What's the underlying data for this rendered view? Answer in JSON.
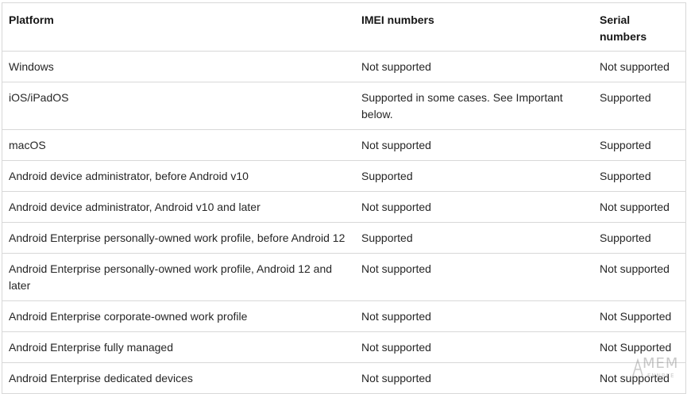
{
  "table": {
    "headers": [
      "Platform",
      "IMEI numbers",
      "Serial numbers"
    ],
    "rows": [
      [
        "Windows",
        "Not supported",
        "Not supported"
      ],
      [
        "iOS/iPadOS",
        "Supported in some cases. See Important below.",
        "Supported"
      ],
      [
        "macOS",
        "Not supported",
        "Supported"
      ],
      [
        "Android device administrator, before Android v10",
        "Supported",
        "Supported"
      ],
      [
        "Android device administrator, Android v10 and later",
        "Not supported",
        "Not supported"
      ],
      [
        "Android Enterprise personally-owned work profile, before Android 12",
        "Supported",
        "Supported"
      ],
      [
        "Android Enterprise personally-owned work profile, Android 12 and later",
        "Not supported",
        "Not supported"
      ],
      [
        "Android Enterprise corporate-owned work profile",
        "Not supported",
        "Not Supported"
      ],
      [
        "Android Enterprise fully managed",
        "Not supported",
        "Not Supported"
      ],
      [
        "Android Enterprise dedicated devices",
        "Not supported",
        "Not supported"
      ]
    ]
  },
  "watermark": {
    "text": "MEM",
    "subtext": "ENNBEE"
  }
}
